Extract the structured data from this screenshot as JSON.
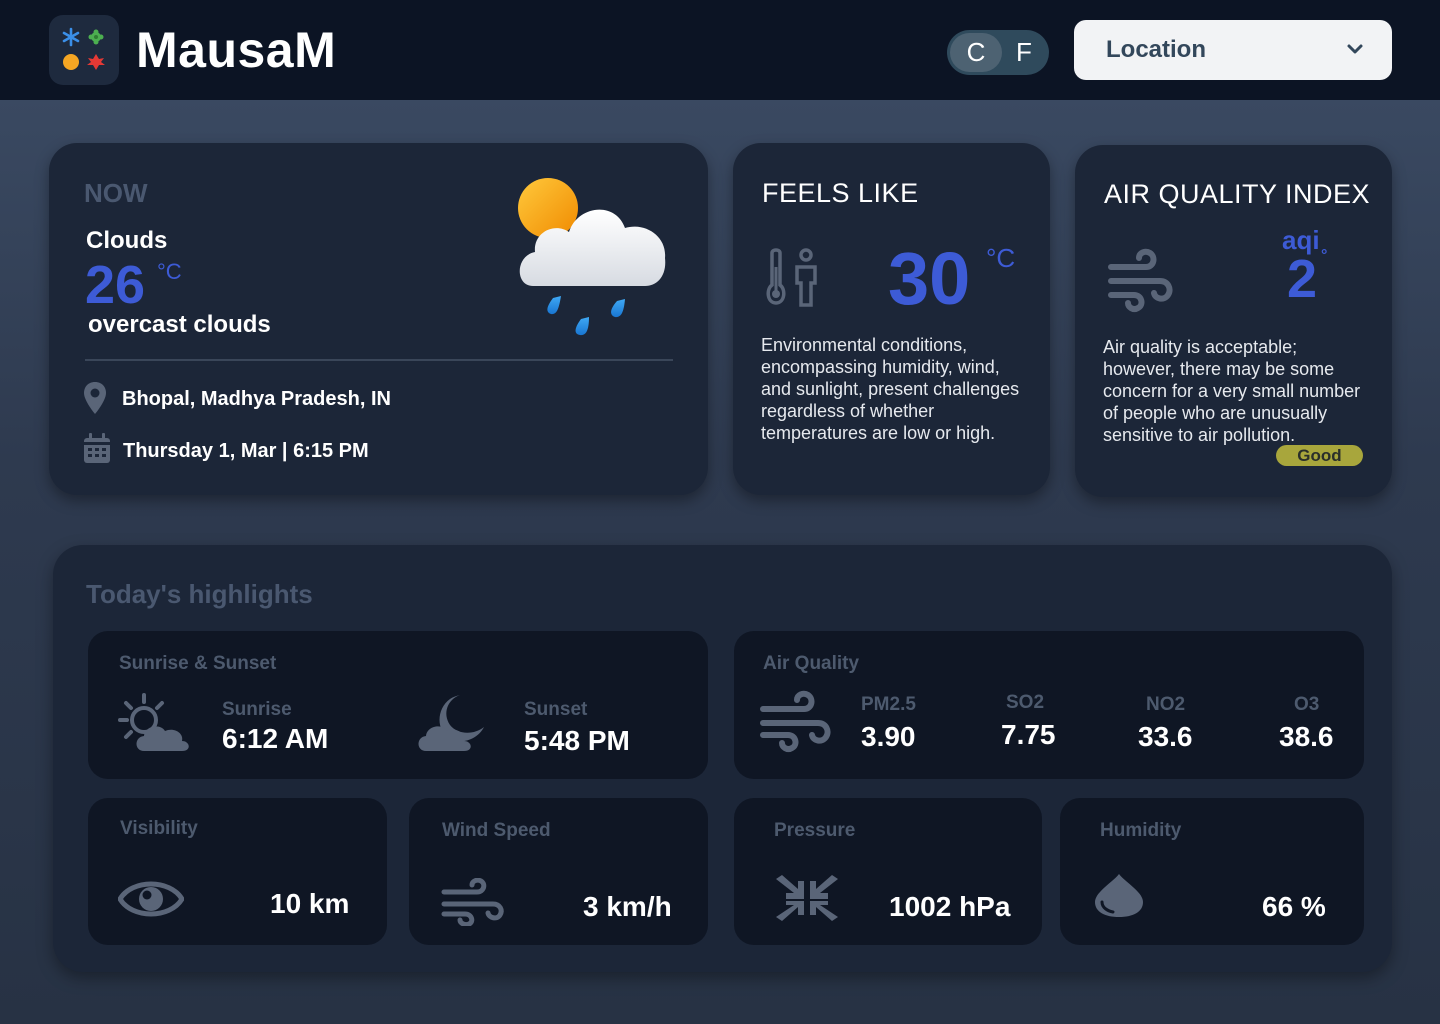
{
  "header": {
    "app_title": "MausaM",
    "unit_toggle": {
      "celsius": "C",
      "fahrenheit": "F",
      "selected": "C"
    },
    "location_select": {
      "label": "Location"
    }
  },
  "now": {
    "label": "NOW",
    "condition": "Clouds",
    "temperature": "26",
    "unit": "°C",
    "description": "overcast clouds",
    "place": "Bhopal, Madhya Pradesh, IN",
    "datetime": "Thursday 1, Mar | 6:15 PM",
    "icon": "sun-cloud-rain-icon"
  },
  "feels_like": {
    "title": "FEELS LIKE",
    "temperature": "30",
    "unit": "°C",
    "description": "Environmental conditions, encompassing humidity, wind, and sunlight, present challenges regardless of whether temperatures are low or high.",
    "icon": "thermometer-person-icon"
  },
  "aqi": {
    "title": "AIR QUALITY INDEX",
    "tag": "aqi",
    "value": "2",
    "degree": "°",
    "description": "Air quality is acceptable; however, there may be some concern for a very small number of people who are unusually sensitive to air pollution.",
    "badge": "Good",
    "badge_color": "#a8a63c",
    "icon": "wind-icon"
  },
  "highlights": {
    "title": "Today's highlights",
    "sun": {
      "label": "Sunrise & Sunset",
      "sunrise_label": "Sunrise",
      "sunrise_value": "6:12 AM",
      "sunset_label": "Sunset",
      "sunset_value": "5:48 PM"
    },
    "air": {
      "label": "Air Quality",
      "items": [
        {
          "label": "PM2.5",
          "value": "3.90"
        },
        {
          "label": "SO2",
          "value": "7.75"
        },
        {
          "label": "NO2",
          "value": "33.6"
        },
        {
          "label": "O3",
          "value": "38.6"
        }
      ]
    },
    "visibility": {
      "label": "Visibility",
      "value": "10 km"
    },
    "wind": {
      "label": "Wind Speed",
      "value": "3 km/h"
    },
    "pressure": {
      "label": "Pressure",
      "value": "1002 hPa"
    },
    "humidity": {
      "label": "Humidity",
      "value": "66 %"
    }
  },
  "colors": {
    "accent": "#3d5bd6",
    "header_bg": "#0c1424",
    "card_bg": "#1c2638",
    "tile_bg": "#0f1624"
  }
}
